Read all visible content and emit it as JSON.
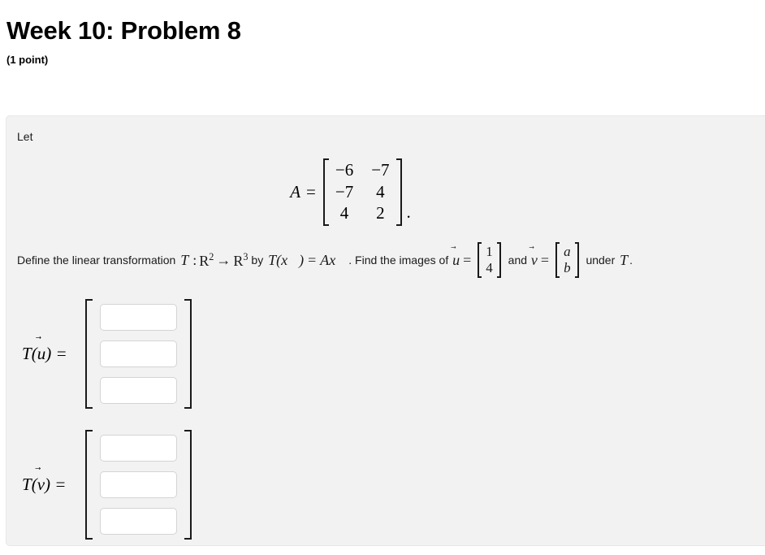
{
  "header": {
    "title": "Week 10: Problem 8",
    "point_value": "(1 point)"
  },
  "problem": {
    "let_label": "Let",
    "matrix_equation": {
      "lhs": "A",
      "equals": "=",
      "matrix": {
        "rows": [
          [
            "−6",
            "−7"
          ],
          [
            "−7",
            "4"
          ],
          [
            "4",
            "2"
          ]
        ]
      },
      "trailing_punctuation": "."
    },
    "sentence": {
      "part1": "Define the linear transformation ",
      "T_symbol": "T",
      "colon": ":",
      "domain": "R",
      "domain_exp": "2",
      "arrow": "→",
      "codomain": "R",
      "codomain_exp": "3",
      "by_text": " by ",
      "T_of_x": "T(x⃗)",
      "equals": "=",
      "Ax": "Ax⃗",
      "part2": ". Find the images of ",
      "u_symbol": "u",
      "u_equals": "=",
      "u_vector": [
        "1",
        "4"
      ],
      "and_text": " and ",
      "v_symbol": "v",
      "v_equals": "=",
      "v_vector": [
        "a",
        "b"
      ],
      "under_text": " under ",
      "under_T": "T",
      "end_punctuation": "."
    },
    "vector_arrow": "⃗",
    "answers": [
      {
        "label_fn": "T",
        "label_var": "u",
        "label_equals": "=",
        "inputs": [
          "",
          "",
          ""
        ],
        "placeholder": ""
      },
      {
        "label_fn": "T",
        "label_var": "v",
        "label_equals": "=",
        "inputs": [
          "",
          "",
          ""
        ],
        "placeholder": ""
      }
    ]
  },
  "colors": {
    "page_background": "#ffffff",
    "panel_background": "#f2f2f2",
    "panel_border": "#e6e6e6",
    "input_border": "#d4d4d4",
    "text": "#000000"
  }
}
